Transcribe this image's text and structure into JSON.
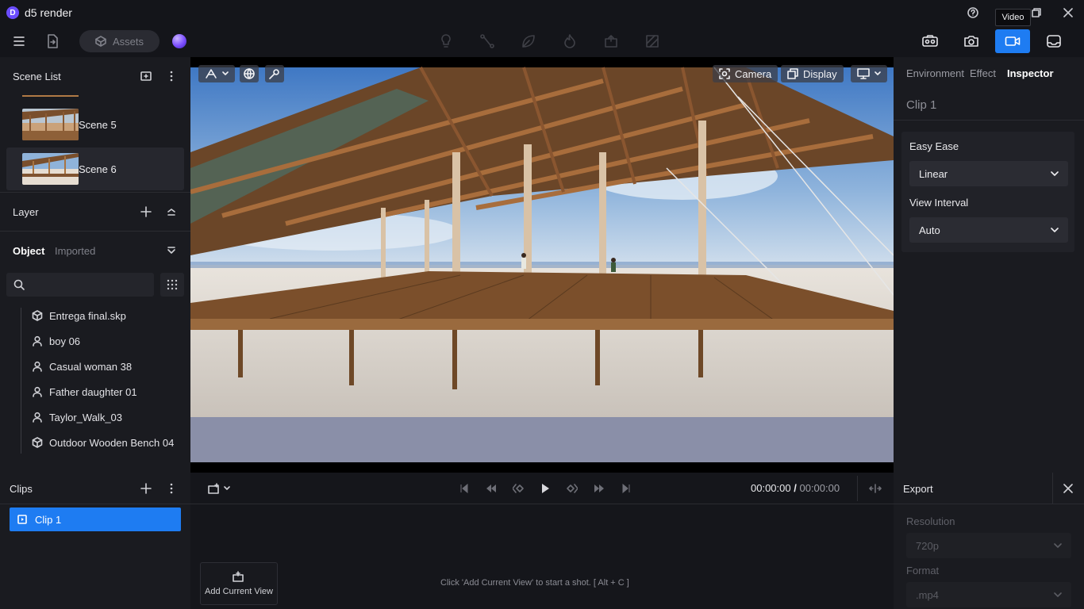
{
  "app": {
    "title": "d5 render",
    "logo_letter": "D"
  },
  "window": {
    "tooltip": "Video"
  },
  "toolbar": {
    "assets_label": "Assets"
  },
  "scene_list": {
    "title": "Scene List",
    "items": [
      {
        "label": "Scene 5"
      },
      {
        "label": "Scene 6"
      }
    ]
  },
  "layer": {
    "title": "Layer"
  },
  "objects": {
    "tabs": [
      {
        "label": "Object"
      },
      {
        "label": "Imported"
      }
    ],
    "search_placeholder": "",
    "items": [
      {
        "label": "Entrega final.skp",
        "icon": "cube-icon"
      },
      {
        "label": "boy 06",
        "icon": "person-icon"
      },
      {
        "label": "Casual woman 38",
        "icon": "person-icon"
      },
      {
        "label": "Father daughter 01",
        "icon": "person-icon"
      },
      {
        "label": "Taylor_Walk_03",
        "icon": "person-icon"
      },
      {
        "label": "Outdoor Wooden Bench 04",
        "icon": "cube-icon"
      }
    ]
  },
  "viewport": {
    "camera_label": "Camera",
    "display_label": "Display"
  },
  "inspector": {
    "tabs": [
      {
        "label": "Environment"
      },
      {
        "label": "Effect"
      },
      {
        "label": "Inspector"
      }
    ],
    "clip_title": "Clip 1",
    "easy_ease_label": "Easy Ease",
    "easy_ease_value": "Linear",
    "view_interval_label": "View Interval",
    "view_interval_value": "Auto"
  },
  "clips": {
    "title": "Clips",
    "items": [
      {
        "label": "Clip 1"
      }
    ]
  },
  "timeline": {
    "current_time": "00:00:00",
    "separator": "/",
    "total_time": "00:00:00",
    "add_view_label": "Add Current View",
    "hint": "Click 'Add Current View' to start a shot. [ Alt + C ]"
  },
  "export": {
    "title": "Export",
    "resolution_label": "Resolution",
    "resolution_value": "720p",
    "format_label": "Format",
    "format_value": ".mp4"
  },
  "colors": {
    "accent": "#1e7cf2",
    "panel": "#1a1b20",
    "background": "#14151a"
  }
}
